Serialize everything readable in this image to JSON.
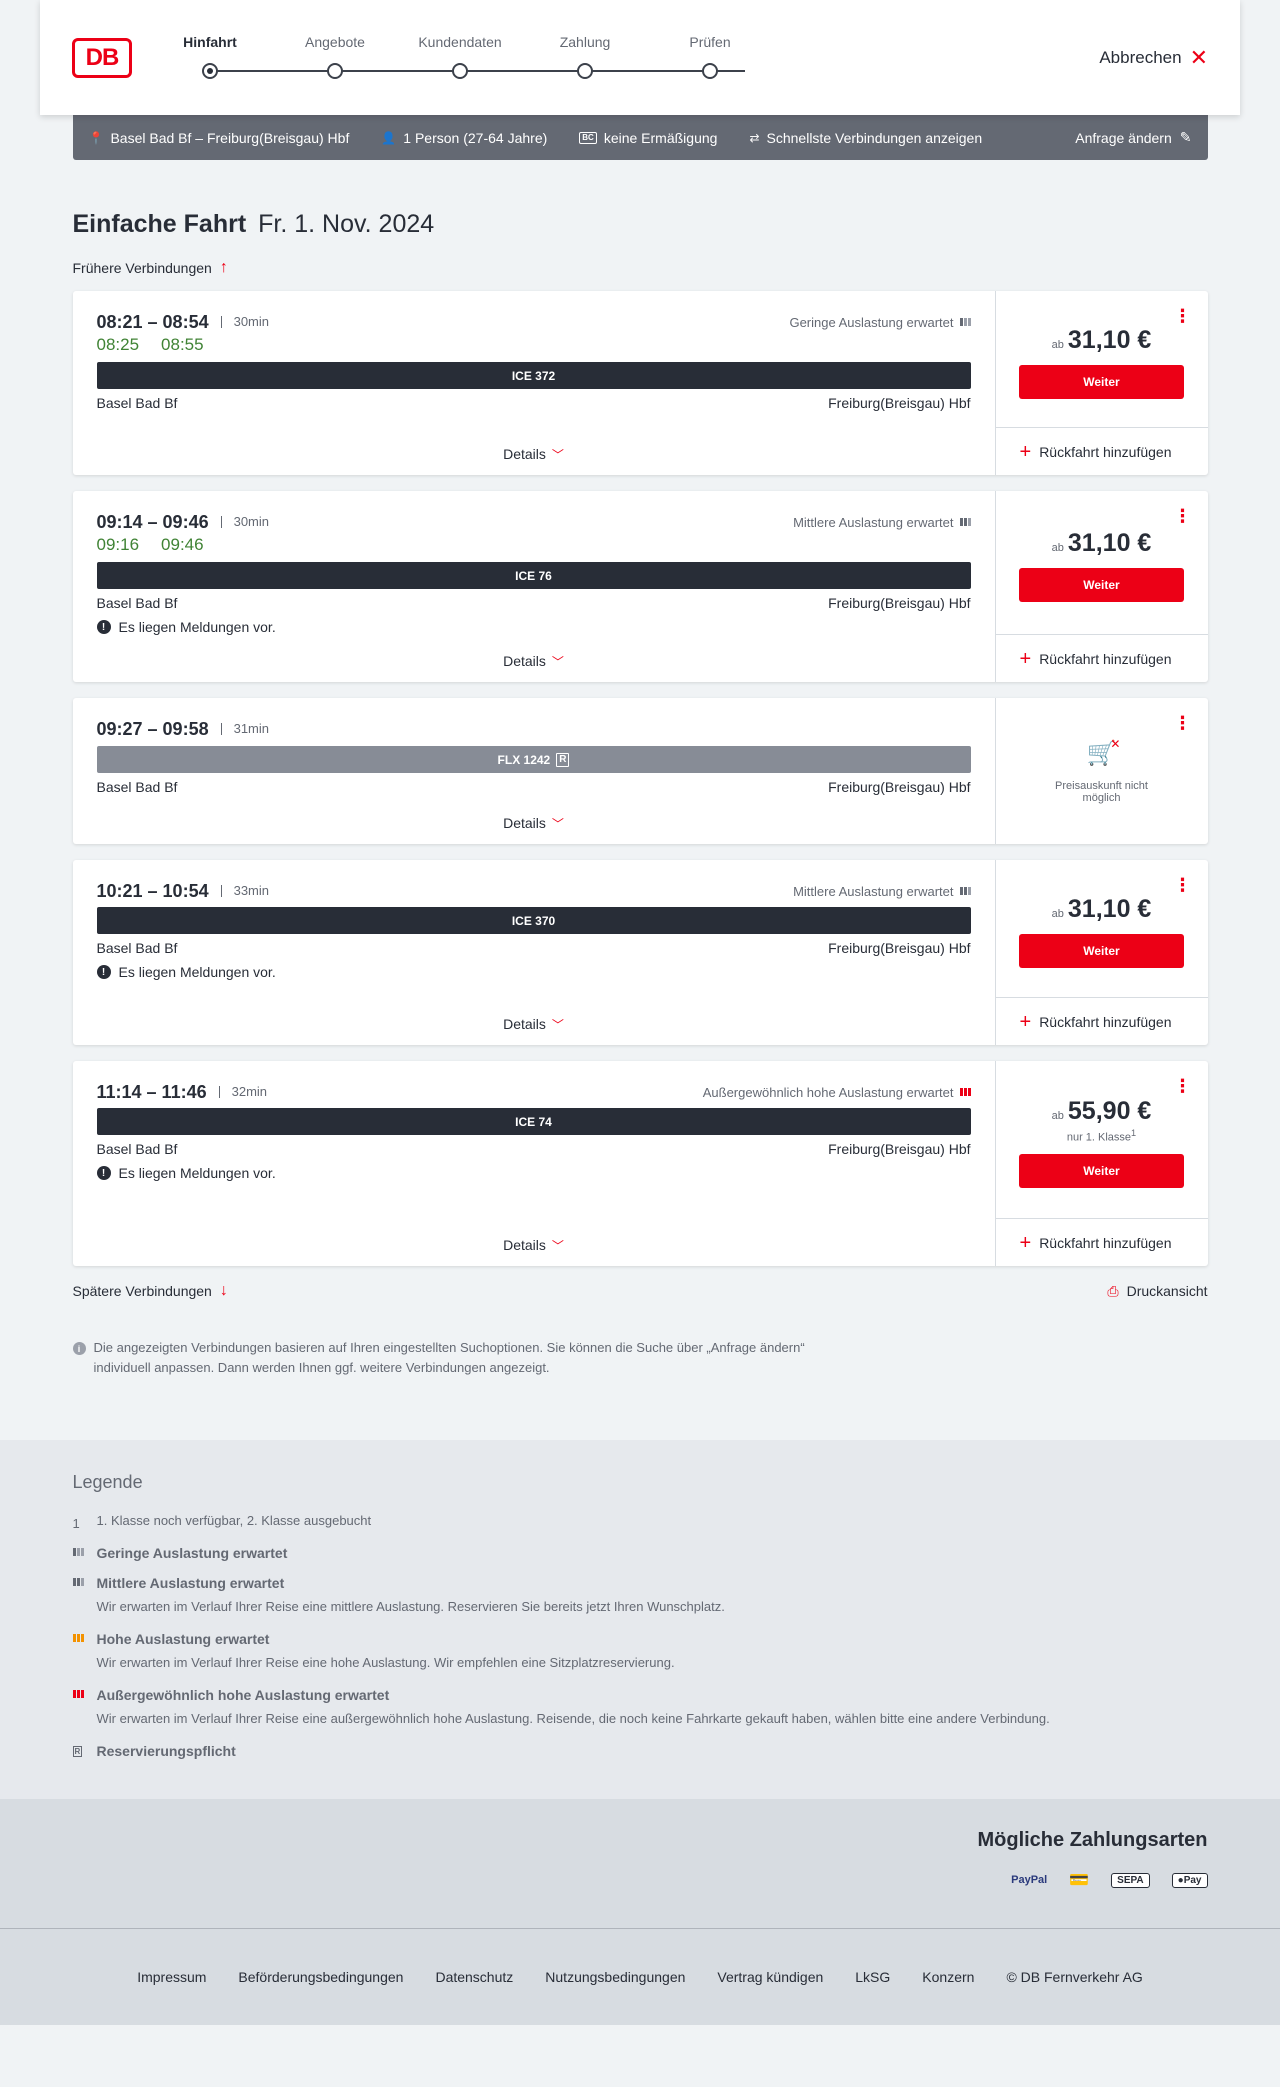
{
  "header": {
    "logo_text": "DB",
    "steps": [
      "Hinfahrt",
      "Angebote",
      "Kundendaten",
      "Zahlung",
      "Prüfen"
    ],
    "cancel_label": "Abbrechen"
  },
  "summary": {
    "route": "Basel Bad Bf – Freiburg(Breisgau) Hbf",
    "persons": "1 Person (27-64 Jahre)",
    "bc_label": "BC",
    "discount": "keine Ermäßigung",
    "fastest": "Schnellste Verbindungen anzeigen",
    "edit": "Anfrage ändern"
  },
  "page": {
    "title": "Einfache Fahrt",
    "date": "Fr. 1. Nov. 2024",
    "earlier": "Frühere Verbindungen",
    "later": "Spätere Verbindungen",
    "print": "Druckansicht",
    "info": "Die angezeigten Verbindungen basieren auf Ihren eingestellten Suchoptionen. Sie können die Suche über „Anfrage ändern“ individuell anpassen. Dann werden Ihnen ggf. weitere Verbindungen angezeigt."
  },
  "labels": {
    "details": "Details",
    "weiter": "Weiter",
    "return": "Rückfahrt hinzufügen",
    "ab": "ab",
    "notice": "Es liegen Meldungen vor.",
    "reservation_badge": "R"
  },
  "connections": [
    {
      "times": "08:21 – 08:54",
      "duration": "30min",
      "rt_dep": "08:25",
      "rt_arr": "08:55",
      "load": "Geringe Auslastung erwartet",
      "load_level": 1,
      "train": "ICE 372",
      "from": "Basel Bad Bf",
      "to": "Freiburg(Breisgau) Hbf",
      "price": "31,10 €"
    },
    {
      "times": "09:14 – 09:46",
      "duration": "30min",
      "rt_dep": "09:16",
      "rt_arr": "09:46",
      "load": "Mittlere Auslastung erwartet",
      "load_level": 2,
      "train": "ICE 76",
      "from": "Basel Bad Bf",
      "to": "Freiburg(Breisgau) Hbf",
      "price": "31,10 €"
    },
    {
      "times": "09:27 – 09:58",
      "duration": "31min",
      "train": "FLX 1242",
      "from": "Basel Bad Bf",
      "to": "Freiburg(Breisgau) Hbf",
      "price_na": "Preisauskunft nicht möglich"
    },
    {
      "times": "10:21 – 10:54",
      "duration": "33min",
      "load": "Mittlere Auslastung erwartet",
      "load_level": 2,
      "train": "ICE 370",
      "from": "Basel Bad Bf",
      "to": "Freiburg(Breisgau) Hbf",
      "price": "31,10 €"
    },
    {
      "times": "11:14 – 11:46",
      "duration": "32min",
      "load": "Außergewöhnlich hohe Auslastung erwartet",
      "load_level": 4,
      "train": "ICE 74",
      "from": "Basel Bad Bf",
      "to": "Freiburg(Breisgau) Hbf",
      "price": "55,90 €",
      "price_note": "nur 1. Klasse",
      "price_note_sup": "1"
    }
  ],
  "legend": {
    "title": "Legende",
    "items": [
      {
        "key": "1",
        "head": "1. Klasse noch verfügbar, 2. Klasse ausgebucht",
        "desc": ""
      },
      {
        "head": "Geringe Auslastung erwartet",
        "desc": ""
      },
      {
        "head": "Mittlere Auslastung erwartet",
        "desc": "Wir erwarten im Verlauf Ihrer Reise eine mittlere Auslastung. Reservieren Sie bereits jetzt Ihren Wunschplatz."
      },
      {
        "head": "Hohe Auslastung erwartet",
        "desc": "Wir erwarten im Verlauf Ihrer Reise eine hohe Auslastung. Wir empfehlen eine Sitzplatzreservierung."
      },
      {
        "head": "Außergewöhnlich hohe Auslastung erwartet",
        "desc": "Wir erwarten im Verlauf Ihrer Reise eine außergewöhnlich hohe Auslastung. Reisende, die noch keine Fahrkarte gekauft haben, wählen bitte eine andere Verbindung."
      },
      {
        "head": "Reservierungspflicht",
        "desc": ""
      }
    ]
  },
  "payment": {
    "title": "Mögliche Zahlungsarten",
    "methods": [
      "PayPal",
      "SEPA",
      "Pay"
    ]
  },
  "footer": {
    "links": [
      "Impressum",
      "Beförderungsbedingungen",
      "Datenschutz",
      "Nutzungsbedingungen",
      "Vertrag kündigen",
      "LkSG",
      "Konzern",
      "© DB Fernverkehr AG"
    ]
  },
  "colors": {
    "brand_red": "#ec0016",
    "realtime_green": "#408335",
    "train_bar": "#282d37"
  }
}
